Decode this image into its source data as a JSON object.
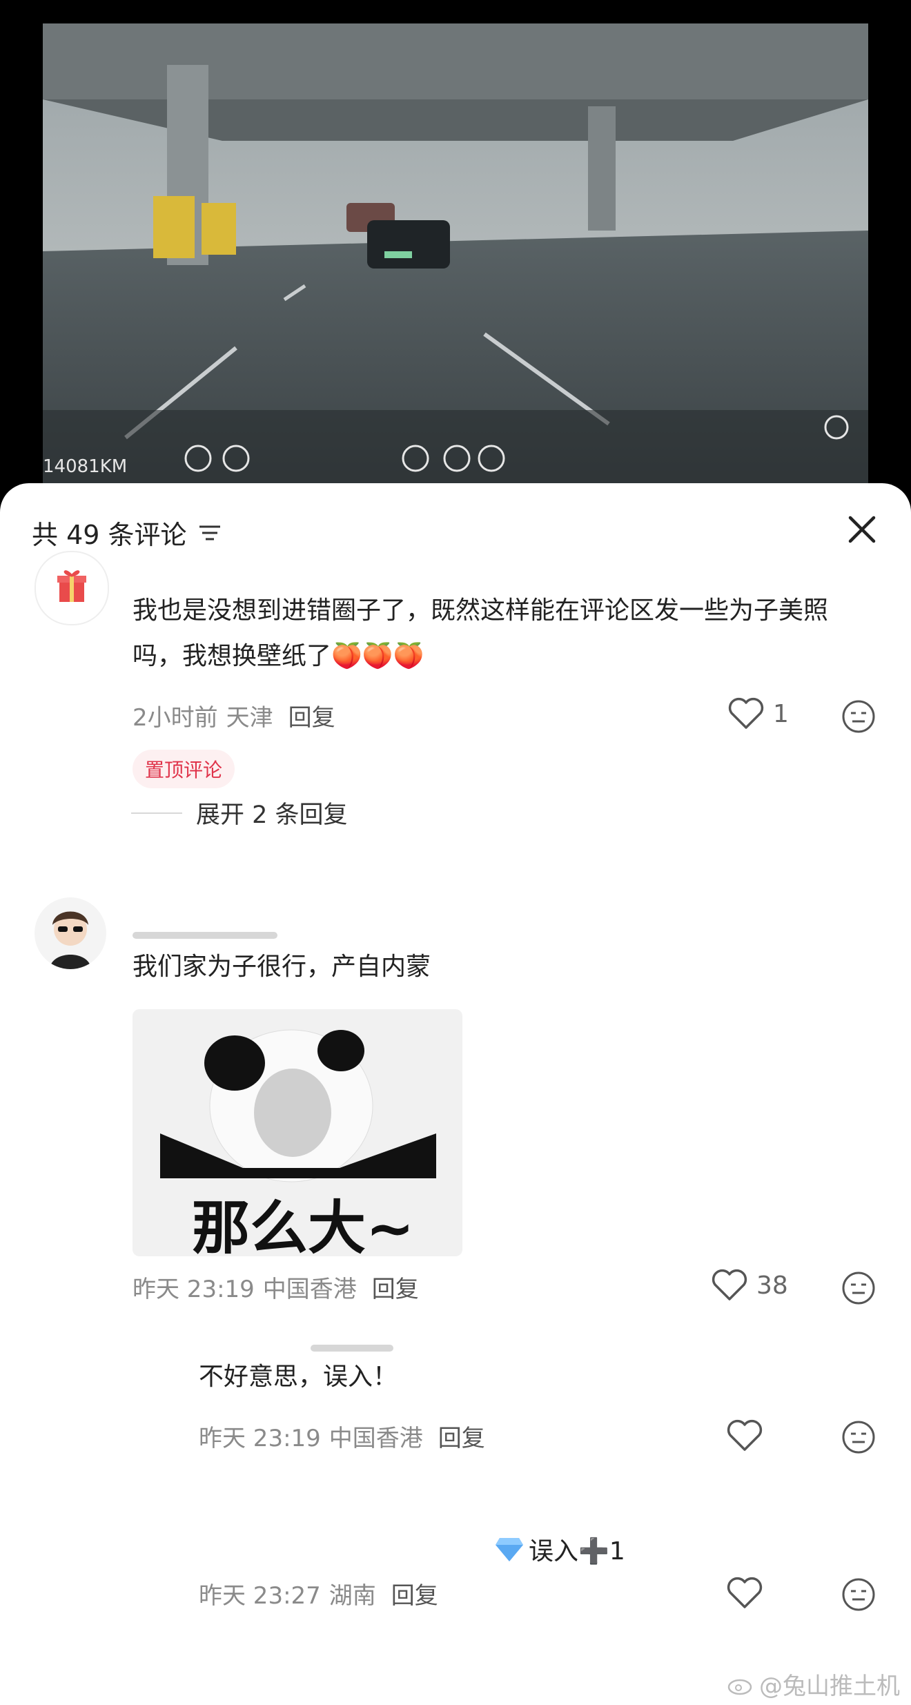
{
  "video": {
    "odometer": "14081KM",
    "description_icons": [
      "speed-icon",
      "park-icon",
      "seatbelt-icon",
      "autopilot-icon",
      "on-indicator-icon",
      "drive-icon",
      "tpms-icon",
      "brake-icon",
      "lane-icon",
      "turn-signal-icon",
      "headlight-icon",
      "fog-light-icon",
      "high-beam-icon",
      "steering-wheel-icon",
      "shield-icon"
    ]
  },
  "header": {
    "title": "共 49 条评论",
    "filter_icon": "filter-icon",
    "close_icon": "close-icon"
  },
  "comments": [
    {
      "avatar_icon": "gift-icon",
      "text": "我也是没想到进错圈子了，既然这样能在评论区发一些为子美照吗，我想换壁纸了",
      "emoji": "🍑🍑🍑",
      "time": "2小时前",
      "location": "天津",
      "reply_label": "回复",
      "likes": "1",
      "badge": "置顶评论",
      "expand_label": "展开 2 条回复"
    },
    {
      "avatar_icon": "sunglasses-avatar-icon",
      "text": "我们家为子很行，产自内蒙",
      "sticker_text": "那么大~",
      "time": "昨天 23:19",
      "location": "中国香港",
      "reply_label": "回复",
      "likes": "38"
    }
  ],
  "replies": [
    {
      "text": "不好意思，误入！",
      "time": "昨天 23:19",
      "location": "中国香港",
      "reply_label": "回复"
    },
    {
      "text": "误入➕1",
      "time": "昨天 23:27",
      "location": "湖南",
      "reply_label": "回复"
    }
  ],
  "watermark": "@兔山推土机",
  "colors": {
    "pin_badge_bg": "#fdf0f1",
    "pin_badge_text": "#e0334a",
    "meta_text": "#8a8a8a"
  }
}
